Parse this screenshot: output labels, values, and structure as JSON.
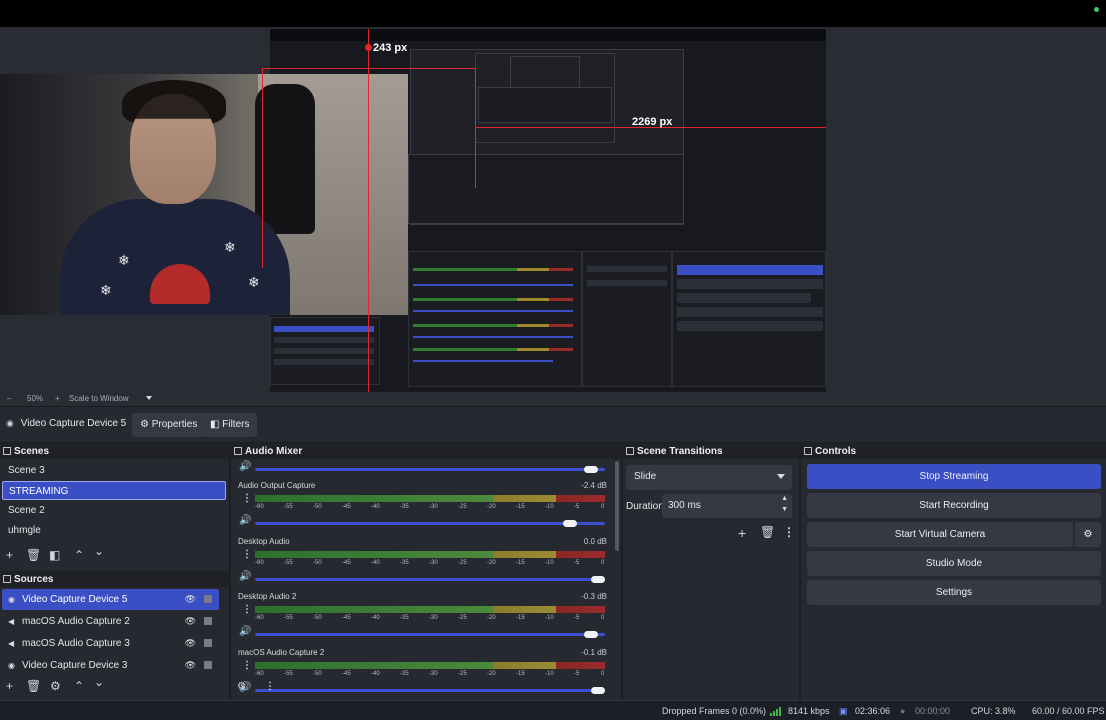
{
  "preview": {
    "measure_width_label": "243 px",
    "measure_height_label": "2269 px",
    "zoom_minus": "–",
    "zoom_level": "50%",
    "zoom_plus": "+",
    "zoom_mode": "Scale to Window"
  },
  "source_toolbar": {
    "source_name": "Video Capture Device 5",
    "properties_label": "Properties",
    "filters_label": "Filters"
  },
  "scenes": {
    "title": "Scenes",
    "items": [
      {
        "label": "Scene 3",
        "selected": false
      },
      {
        "label": "STREAMING",
        "selected": true
      },
      {
        "label": "Scene 2",
        "selected": false
      },
      {
        "label": "uhmgle",
        "selected": false
      }
    ]
  },
  "sources": {
    "title": "Sources",
    "items": [
      {
        "label": "Video Capture Device 5",
        "icon": "camera-icon",
        "selected": true
      },
      {
        "label": "macOS Audio Capture 2",
        "icon": "speaker-icon",
        "selected": false
      },
      {
        "label": "macOS Audio Capture 3",
        "icon": "speaker-icon",
        "selected": false
      },
      {
        "label": "Video Capture Device 3",
        "icon": "camera-icon",
        "selected": false
      }
    ]
  },
  "audio_mixer": {
    "title": "Audio Mixer",
    "scale_ticks": [
      "-60",
      "-55",
      "-50",
      "-45",
      "-40",
      "-35",
      "-30",
      "-25",
      "-20",
      "-15",
      "-10",
      "-5",
      "0"
    ],
    "channels": [
      {
        "name": "Audio Output Capture",
        "db": "-2.4 dB",
        "volume": 0.92
      },
      {
        "name": "Desktop Audio",
        "db": "0.0 dB",
        "volume": 1.0
      },
      {
        "name": "Desktop Audio 2",
        "db": "-0.3 dB",
        "volume": 0.98
      },
      {
        "name": "macOS Audio Capture 2",
        "db": "-0.1 dB",
        "volume": 1.0
      }
    ],
    "top_partial_volume": 0.98
  },
  "scene_transitions": {
    "title": "Scene Transitions",
    "transition": "Slide",
    "duration_label": "Duration",
    "duration_value": "300 ms"
  },
  "controls": {
    "title": "Controls",
    "stop_streaming": "Stop Streaming",
    "start_recording": "Start Recording",
    "start_virtual_camera": "Start Virtual Camera",
    "studio_mode": "Studio Mode",
    "settings": "Settings"
  },
  "status": {
    "dropped_frames": "Dropped Frames 0 (0.0%)",
    "bitrate": "8141 kbps",
    "stream_time": "02:36:06",
    "record_time": "00:00:00",
    "cpu": "CPU: 3.8%",
    "fps": "60.00 / 60.00 FPS"
  },
  "colors": {
    "accent": "#3b4fc4",
    "panel": "#272930",
    "background": "#1d1f26",
    "measure_line": "#e3262e"
  }
}
